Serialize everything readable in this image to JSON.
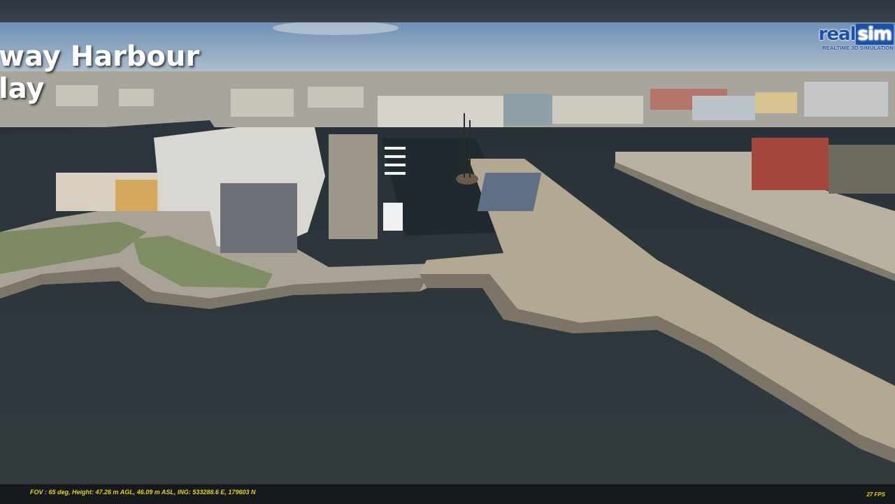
{
  "overlay": {
    "title": "way Harbour\nlay"
  },
  "brand": {
    "name_real": "real",
    "name_sim": "sim",
    "tagline": "REALTIME 3D SIMULATION",
    "color": "#1b4fa8"
  },
  "status": {
    "readout": "FOV : 65 deg, Height: 47.26 m AGL, 46.09 m ASL, ING: 533288.6 E, 179603 N",
    "fps": "27 FPS",
    "text_color": "#e6d21a"
  },
  "scene": {
    "sky_color": "#8aa3c0",
    "water_color": "#2c3438",
    "pier_color": "#b3a892"
  }
}
